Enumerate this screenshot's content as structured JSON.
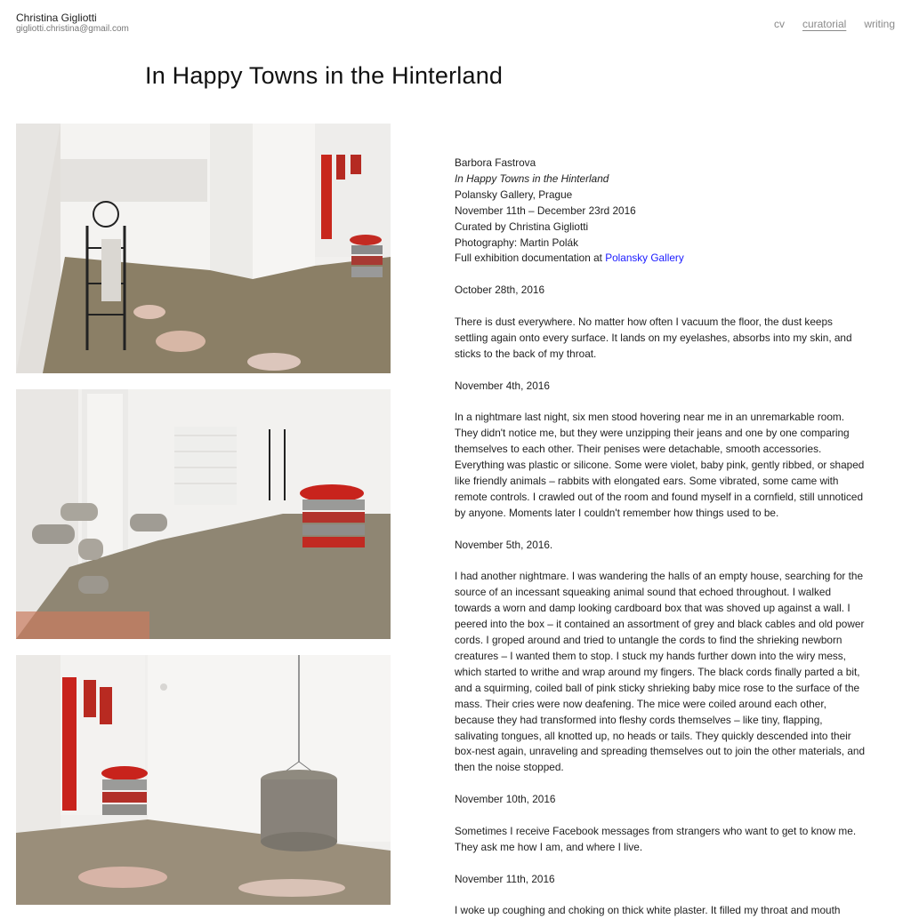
{
  "header": {
    "name": "Christina Gigliotti",
    "email": "gigliotti.christina@gmail.com",
    "nav": [
      "cv",
      "curatorial",
      "writing"
    ]
  },
  "page_title": "In Happy Towns in the Hinterland",
  "credits": {
    "artist": "Barbora Fastrova",
    "title": "In Happy Towns in the Hinterland",
    "venue": "Polansky Gallery, Prague",
    "dates": "November 11th – December 23rd 2016",
    "curated": "Curated by Christina Gigliotti",
    "photography": "Photography: Martin Polák",
    "doc_prefix": "Full exhibition documentation at ",
    "doc_link": "Polansky Gallery"
  },
  "entries": [
    {
      "date": "October 28th, 2016",
      "text": "There is dust everywhere. No matter how often I vacuum the floor, the dust keeps settling again onto every surface. It lands on my eyelashes, absorbs into my skin, and sticks to the back of my throat."
    },
    {
      "date": "November 4th, 2016",
      "text": "In a nightmare last night, six men stood hovering near me in an unremarkable room. They didn't notice me, but they were unzipping their jeans and one by one comparing themselves to each other. Their penises were detachable, smooth accessories. Everything was plastic or silicone. Some were violet, baby pink, gently ribbed, or shaped like friendly animals – rabbits with elongated ears. Some vibrated, some came with remote controls. I crawled out of the room and found myself in a cornfield, still unnoticed by anyone. Moments later I couldn't remember how things used to be."
    },
    {
      "date": "November 5th, 2016.",
      "text": "I had another nightmare. I was wandering the halls of an empty house, searching for the source of an incessant squeaking animal sound that echoed throughout. I walked towards a worn and damp looking cardboard box that was shoved up against a wall. I peered into the box – it contained an assortment of grey and black cables and old power cords. I groped around and tried to untangle the cords to find the shrieking newborn creatures – I wanted them to stop. I stuck my hands further down into the wiry mess, which started to writhe and wrap around my fingers. The black cords finally parted a bit, and a squirming, coiled ball of pink sticky shrieking baby mice rose to the surface of the mass. Their cries were now deafening. The mice were coiled around each other, because they had transformed into fleshy cords themselves – like tiny, flapping, salivating tongues, all knotted up, no heads or tails. They quickly descended into their box-nest again, unraveling and spreading themselves out to join the other materials, and then the noise stopped."
    },
    {
      "date": "November 10th, 2016",
      "text": "Sometimes I receive Facebook messages from strangers who want to get to know me. They ask me how I am, and where I live."
    },
    {
      "date": "November 11th, 2016",
      "text": "I woke up coughing and choking on thick white plaster. It filled my throat and mouth"
    }
  ]
}
